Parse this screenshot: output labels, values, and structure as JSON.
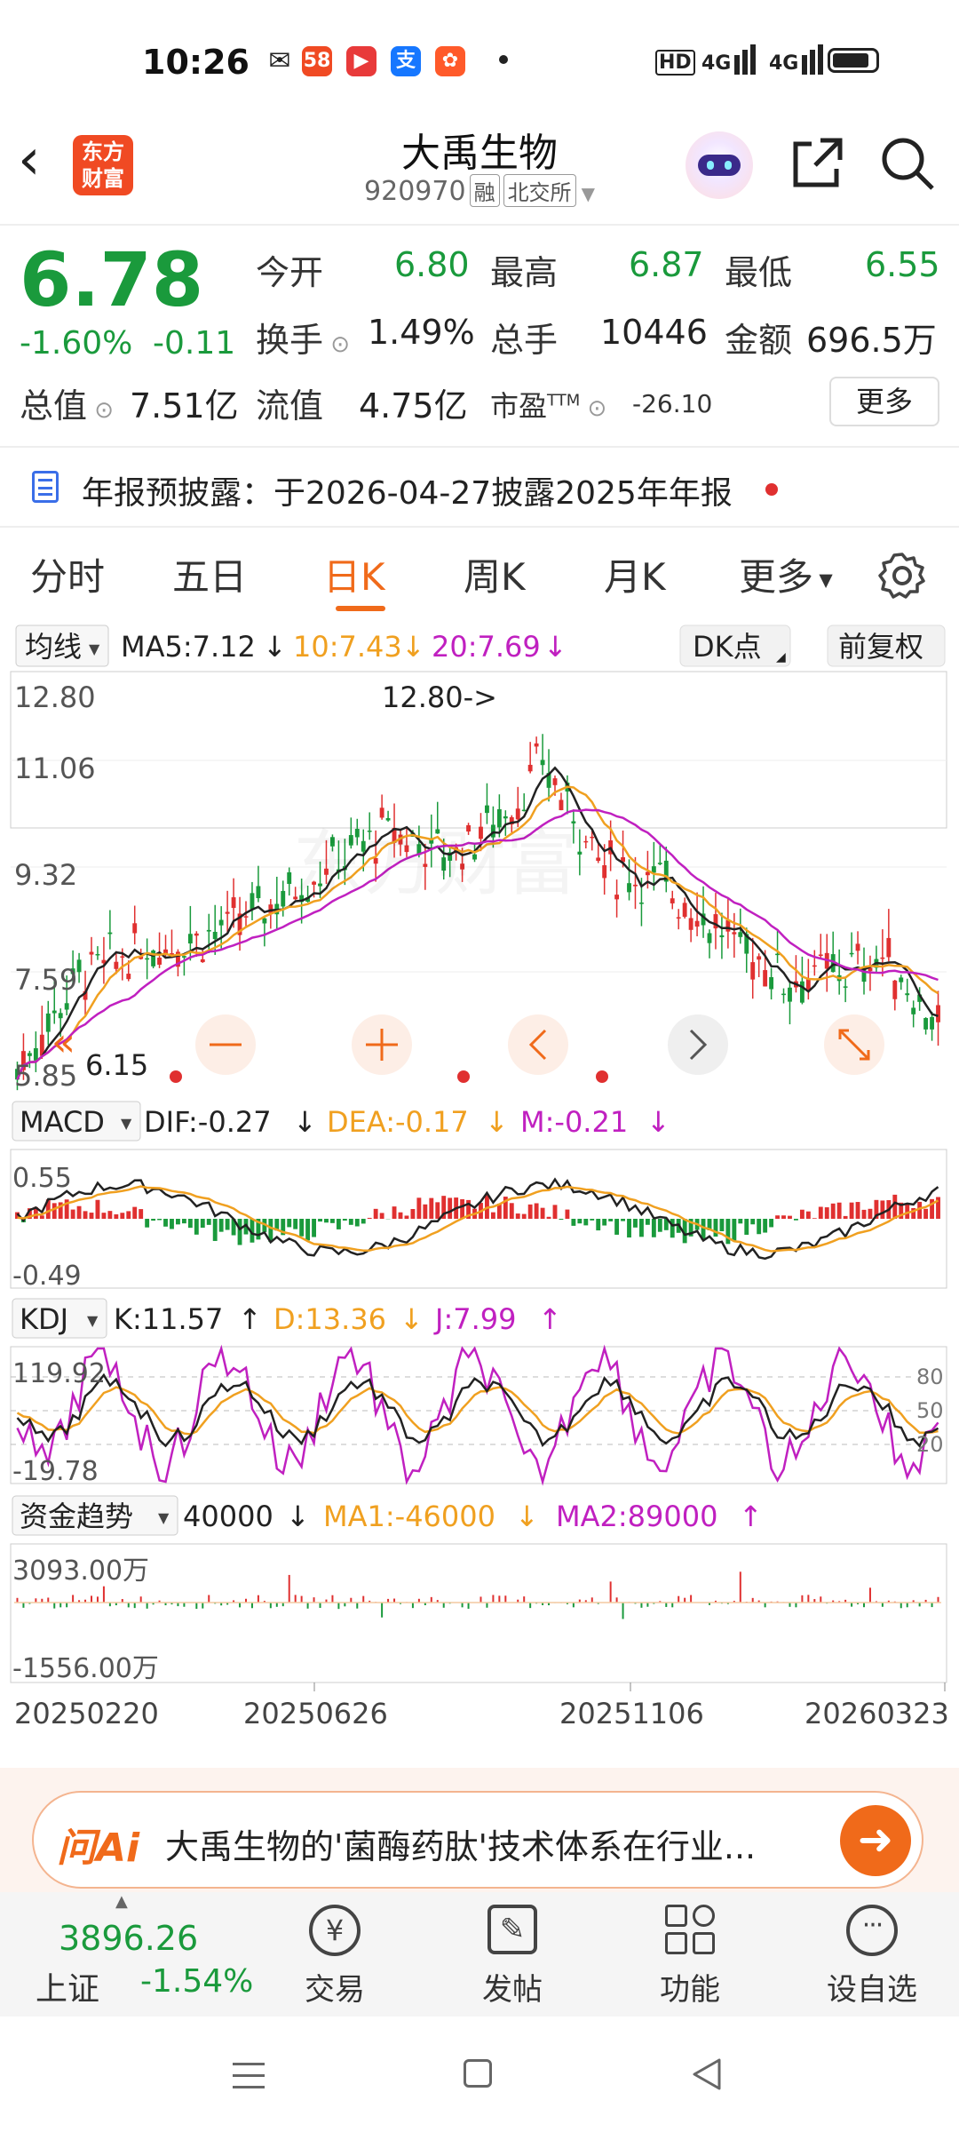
{
  "status_bar": {
    "time": "10:26",
    "network": "4G",
    "network2": "4G"
  },
  "header": {
    "logo_line1": "东方",
    "logo_line2": "财富",
    "title": "大禹生物",
    "code": "920970",
    "tag_margin": "融",
    "tag_exchange": "北交所"
  },
  "quote": {
    "price": "6.78",
    "change_pct": "-1.60%",
    "change": "-0.11",
    "open_label": "今开",
    "open": "6.80",
    "high_label": "最高",
    "high": "6.87",
    "low_label": "最低",
    "low": "6.55",
    "turnover_label": "换手",
    "turnover": "1.49%",
    "volume_label": "总手",
    "volume": "10446",
    "amount_label": "金额",
    "amount": "696.5万",
    "mktcap_label": "总值",
    "mktcap": "7.51亿",
    "float_label": "流值",
    "float": "4.75亿",
    "pe_label": "市盈",
    "pe_sup": "TTM",
    "pe": "-26.10",
    "more_button": "更多"
  },
  "notice": {
    "text": "年报预披露：于2026-04-27披露2025年年报"
  },
  "tabs": [
    "分时",
    "五日",
    "日K",
    "周K",
    "月K",
    "更多"
  ],
  "active_tab": "日K",
  "kline": {
    "indicator": "均线",
    "ma5": "MA5:7.12",
    "ma10": "10:7.43",
    "ma20": "20:7.69",
    "dk_button": "DK点",
    "adjust_button": "前复权",
    "axis": [
      "12.80",
      "11.06",
      "9.32",
      "7.59",
      "5.85"
    ],
    "max_label": "12.80->",
    "min_label": "6.15"
  },
  "macd": {
    "name": "MACD",
    "dif": "DIF:-0.27",
    "dea": "DEA:-0.17",
    "m": "M:-0.21",
    "axis_top": "0.55",
    "axis_bottom": "-0.49"
  },
  "kdj": {
    "name": "KDJ",
    "k": "K:11.57",
    "d": "D:13.36",
    "j": "J:7.99",
    "axis_top": "119.92",
    "axis_bottom": "-19.78",
    "right_axis": [
      "80",
      "50",
      "20"
    ]
  },
  "fund": {
    "name": "资金趋势",
    "value": "40000",
    "ma1": "MA1:-46000",
    "ma2": "MA2:89000",
    "axis_top": "3093.00万",
    "axis_bottom": "-1556.00万"
  },
  "dates": [
    "20250220",
    "20250626",
    "20251106",
    "20260323"
  ],
  "ai_bar": {
    "logo": "问Ai",
    "text": "大禹生物的'菌酶药肽'技术体系在行业..."
  },
  "bottom_nav": {
    "index_value": "3896.26",
    "index_name": "上证",
    "index_change": "-1.54%",
    "items": [
      "交易",
      "发帖",
      "功能",
      "设自选"
    ]
  },
  "colors": {
    "up": "#e03030",
    "down": "#1a9a3c",
    "accent": "#f06a1a",
    "ma10": "#f0a020",
    "ma20": "#c020c0"
  }
}
